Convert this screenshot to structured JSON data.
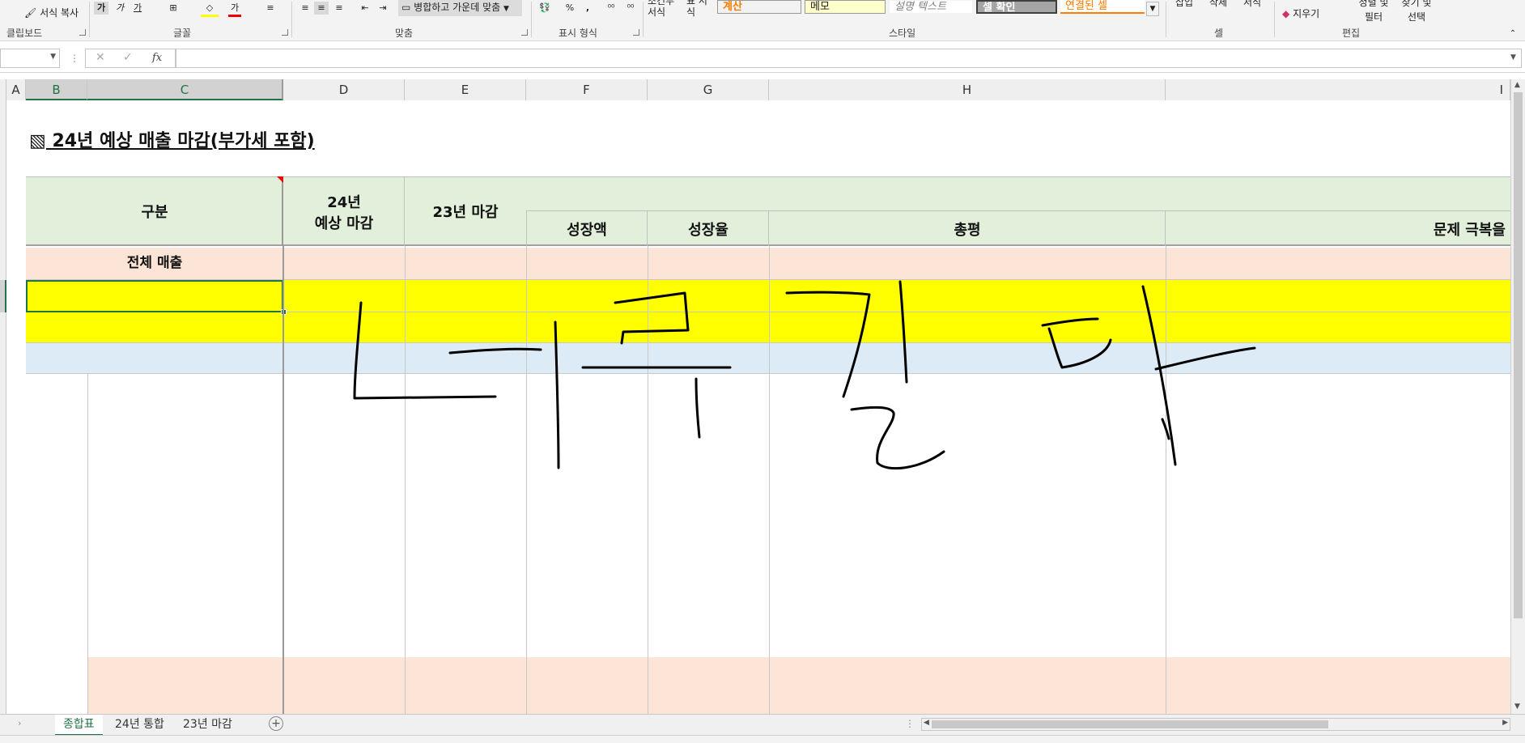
{
  "ribbon": {
    "clipboard": {
      "format_painter": "서식 복사",
      "group_label": "클립보드"
    },
    "font": {
      "bold": "가",
      "italic": "가",
      "underline": "가",
      "group_label": "글꼴"
    },
    "alignment": {
      "merge_center": "병합하고 가운데 맞춤",
      "group_label": "맞춤"
    },
    "number": {
      "percent": "%",
      "comma": ",",
      "group_label": "표시 형식"
    },
    "styles": {
      "conditional": "조건부 서식",
      "table_format": "표 서식",
      "boxes": [
        "계산",
        "메모",
        "설명 텍스트",
        "셀 확인",
        "연결된 셀"
      ],
      "group_label": "스타일"
    },
    "cells": {
      "insert": "삽입",
      "delete": "삭제",
      "format": "서식",
      "group_label": "셀"
    },
    "editing": {
      "clear": "지우기",
      "sort_filter": "정렬 및 필터",
      "find_select": "찾기 및 선택",
      "group_label": "편집"
    }
  },
  "formula_bar": {
    "name_box": "",
    "fx": "fx",
    "formula": ""
  },
  "columns": [
    "A",
    "B",
    "C",
    "D",
    "E",
    "F",
    "G",
    "H",
    "I"
  ],
  "sheet": {
    "title": "▧ 24년 예상 매출 마감(부가세 포함)",
    "headers": {
      "category": "구분",
      "forecast_line1": "24년",
      "forecast_line2": "예상 마감",
      "prev_close": "23년 마감",
      "growth_amount": "성장액",
      "growth_rate": "성장율",
      "review": "총평",
      "issue": "문제 극복을"
    },
    "total_row_label": "전체 매출"
  },
  "tabs": [
    "종합표",
    "24년 통합",
    "23년 마감"
  ],
  "colors": {
    "green_header": "#e2efda",
    "peach": "#fce4d6",
    "yellow": "#ffff00",
    "blue": "#ddebf7",
    "excel_green": "#217346"
  }
}
